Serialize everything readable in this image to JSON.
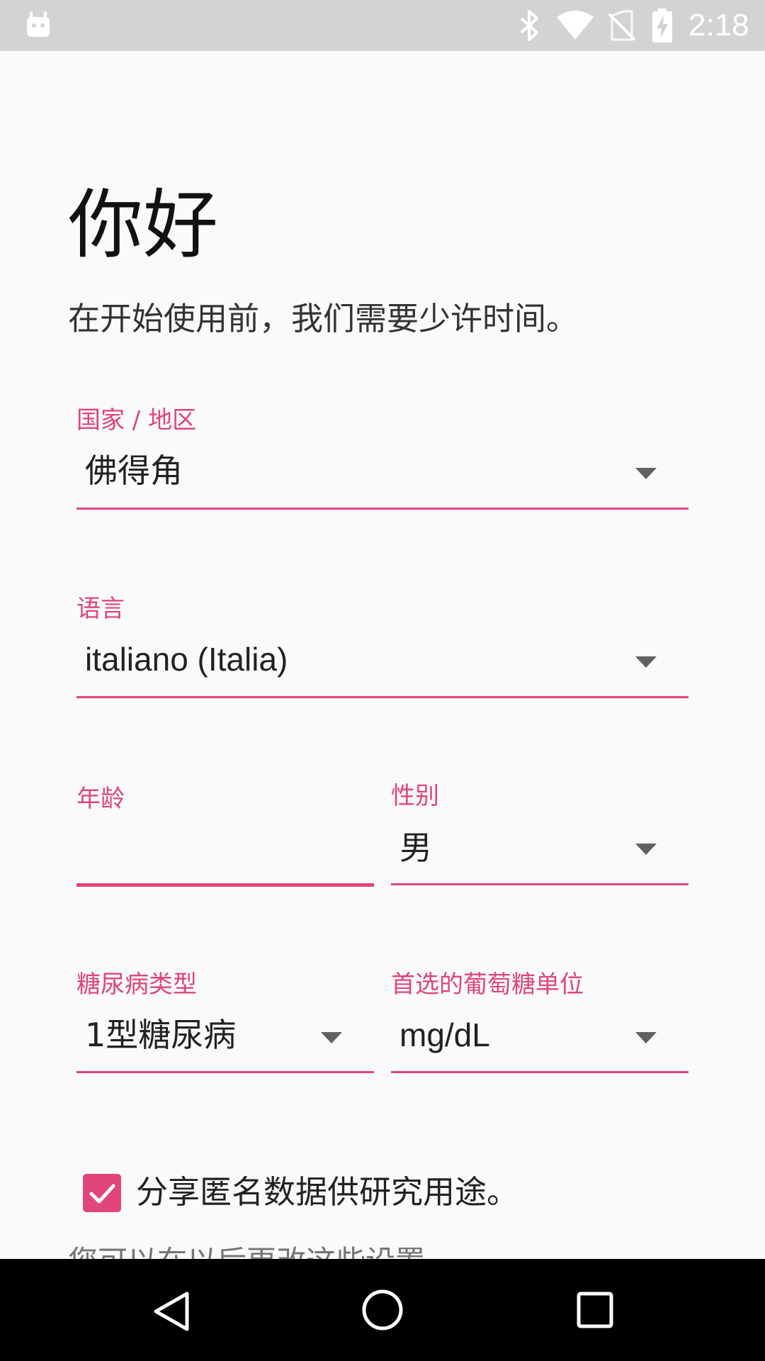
{
  "status_bar": {
    "time": "2:18",
    "icons": [
      "android-debug-icon",
      "bluetooth-icon",
      "wifi-icon",
      "no-sim-icon",
      "battery-charging-icon"
    ]
  },
  "header": {
    "title": "你好",
    "subtitle": "在开始使用前，我们需要少许时间。"
  },
  "form": {
    "country": {
      "label": "国家 / 地区",
      "value": "佛得角"
    },
    "language": {
      "label": "语言",
      "value": "italiano (Italia)"
    },
    "age": {
      "label": "年龄",
      "value": ""
    },
    "gender": {
      "label": "性别",
      "value": "男"
    },
    "diabetes_type": {
      "label": "糖尿病类型",
      "value": "1型糖尿病"
    },
    "glucose_unit": {
      "label": "首选的葡萄糖单位",
      "value": "mg/dL"
    }
  },
  "consent": {
    "checked": true,
    "label": "分享匿名数据供研究用途。",
    "note": "您可以在以后更改这些设置。"
  },
  "nav_bar": {
    "buttons": [
      "back-icon",
      "home-icon",
      "recents-icon"
    ]
  },
  "colors": {
    "accent": "#e0457b",
    "status_bar": "#d3d3d3",
    "nav_bar": "#000000",
    "background": "#fafafa"
  }
}
